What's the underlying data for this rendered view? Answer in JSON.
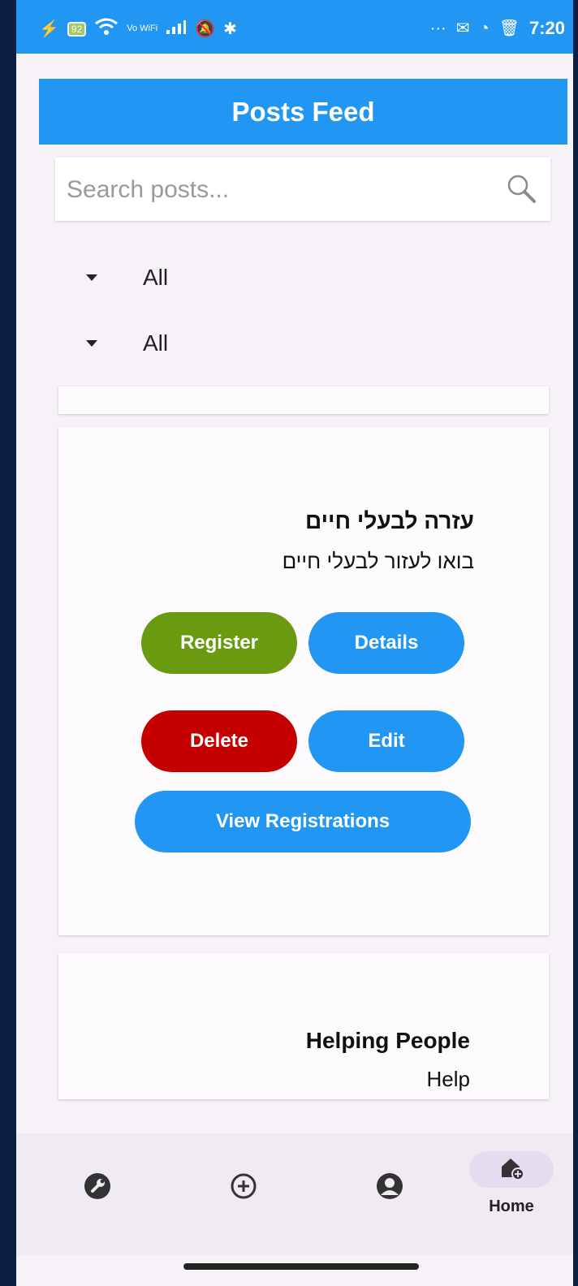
{
  "status_bar": {
    "battery": "92",
    "network": "Vo WiFi",
    "time": "7:20",
    "more": "···"
  },
  "app_bar": {
    "title": "Posts Feed"
  },
  "search": {
    "placeholder": "Search posts...",
    "icon": "search-icon"
  },
  "filters": [
    {
      "value": "All"
    },
    {
      "value": "All"
    }
  ],
  "posts": [
    {
      "title": "עזרה לבעלי חיים",
      "description": "בואו לעזור לבעלי חיים",
      "buttons": {
        "register": "Register",
        "details": "Details",
        "delete": "Delete",
        "edit": "Edit",
        "view_registrations": "View Registrations"
      }
    },
    {
      "title": "Helping People",
      "description": "Help"
    }
  ],
  "bottom_nav": {
    "items": [
      {
        "icon": "wrench-icon"
      },
      {
        "icon": "add-circle-icon"
      },
      {
        "icon": "account-icon"
      },
      {
        "icon": "home-icon",
        "label": "Home",
        "active": true
      }
    ]
  },
  "colors": {
    "primary": "#2196f3",
    "register": "#6a9a10",
    "delete": "#c40000",
    "background": "#f6f2f8"
  }
}
